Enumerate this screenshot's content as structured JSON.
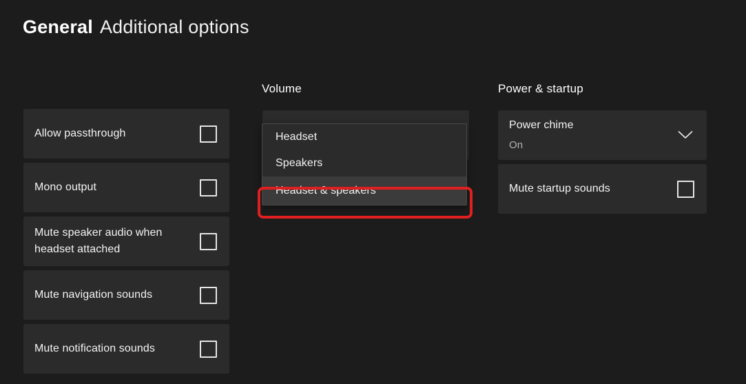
{
  "header": {
    "title_bold": "General",
    "title_light": "Additional options"
  },
  "colors": {
    "page_background": "#1c1c1c",
    "card_background": "#2b2b2b",
    "selected_item_background": "#3b3b3b",
    "highlight_red": "#e02020",
    "text_primary": "#f4f4f4",
    "text_secondary": "#b3b3b3"
  },
  "left_column": {
    "items": [
      {
        "label": "Allow passthrough",
        "control": "checkbox",
        "checked": false
      },
      {
        "label": "Mono output",
        "control": "checkbox",
        "checked": false
      },
      {
        "label": "Mute speaker audio when headset attached",
        "control": "checkbox",
        "checked": false
      },
      {
        "label": "Mute navigation sounds",
        "control": "checkbox",
        "checked": false
      },
      {
        "label": "Mute notification sounds",
        "control": "checkbox",
        "checked": false
      }
    ]
  },
  "volume_column": {
    "heading": "Volume",
    "dropdown": {
      "expanded": true,
      "options": [
        {
          "label": "Headset",
          "selected": false
        },
        {
          "label": "Speakers",
          "selected": false
        },
        {
          "label": "Headset & speakers",
          "selected": true
        }
      ],
      "highlighted_option": "Headset & speakers"
    }
  },
  "power_column": {
    "heading": "Power & startup",
    "items": [
      {
        "label": "Power chime",
        "value": "On",
        "control": "chevron-down"
      },
      {
        "label": "Mute startup sounds",
        "control": "checkbox",
        "checked": false
      }
    ]
  }
}
